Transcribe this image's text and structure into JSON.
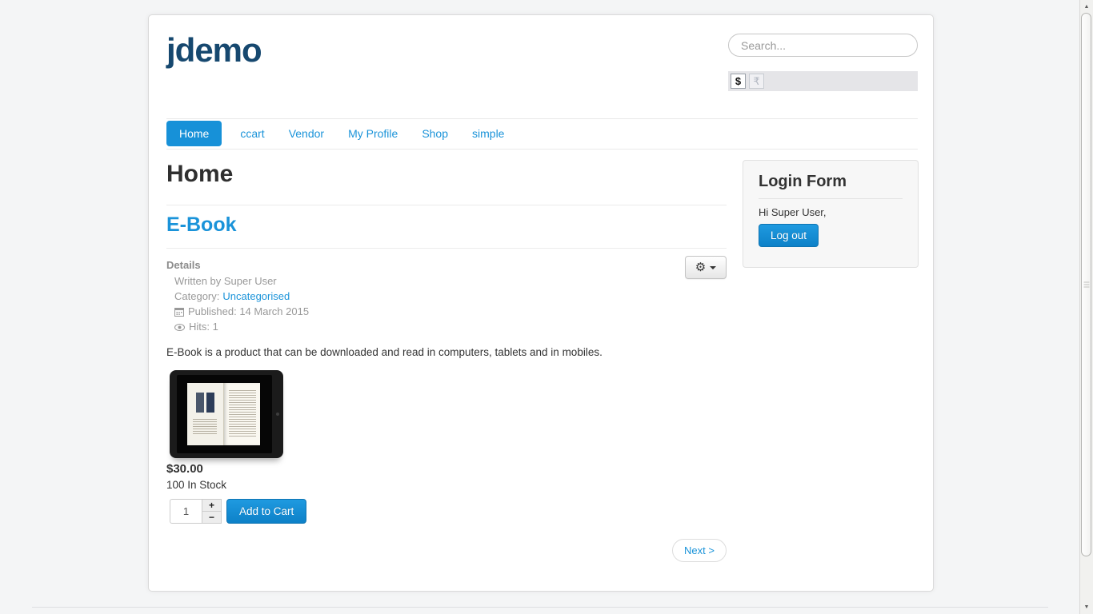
{
  "header": {
    "logo": "jdemo",
    "search": {
      "placeholder": "Search..."
    },
    "currency": {
      "dollar_label": "$",
      "rupee_label": "₹"
    }
  },
  "nav": {
    "items": [
      {
        "label": "Home",
        "active": true
      },
      {
        "label": "ccart"
      },
      {
        "label": "Vendor"
      },
      {
        "label": "My Profile"
      },
      {
        "label": "Shop"
      },
      {
        "label": "simple"
      }
    ]
  },
  "main": {
    "page_title": "Home",
    "article_title": "E-Book",
    "details": {
      "label": "Details",
      "written_by": "Written by Super User",
      "category_label": "Category:",
      "category_link": "Uncategorised",
      "published": "Published: 14 March 2015",
      "hits": "Hits: 1"
    },
    "gear_icon_glyph": "⚙",
    "body_text": "E-Book is a product that can be downloaded and read in computers, tablets and in mobiles.",
    "product": {
      "price": "$30.00",
      "stock": "100 In Stock",
      "quantity": "1",
      "increase_label": "+",
      "decrease_label": "−",
      "add_to_cart_label": "Add to Cart"
    },
    "pagination": {
      "next_label": "Next >"
    }
  },
  "sidebar": {
    "login": {
      "title": "Login Form",
      "greeting": "Hi Super User,",
      "logout_label": "Log out"
    }
  },
  "scrollbar": {
    "up_glyph": "▲",
    "down_glyph": "▼"
  },
  "colors": {
    "accent": "#1a93d9",
    "nav_active_bg": "#1791d8",
    "logo": "#16486f",
    "button_blue": "#0d81c8",
    "page_bg": "#f4f5f6"
  }
}
